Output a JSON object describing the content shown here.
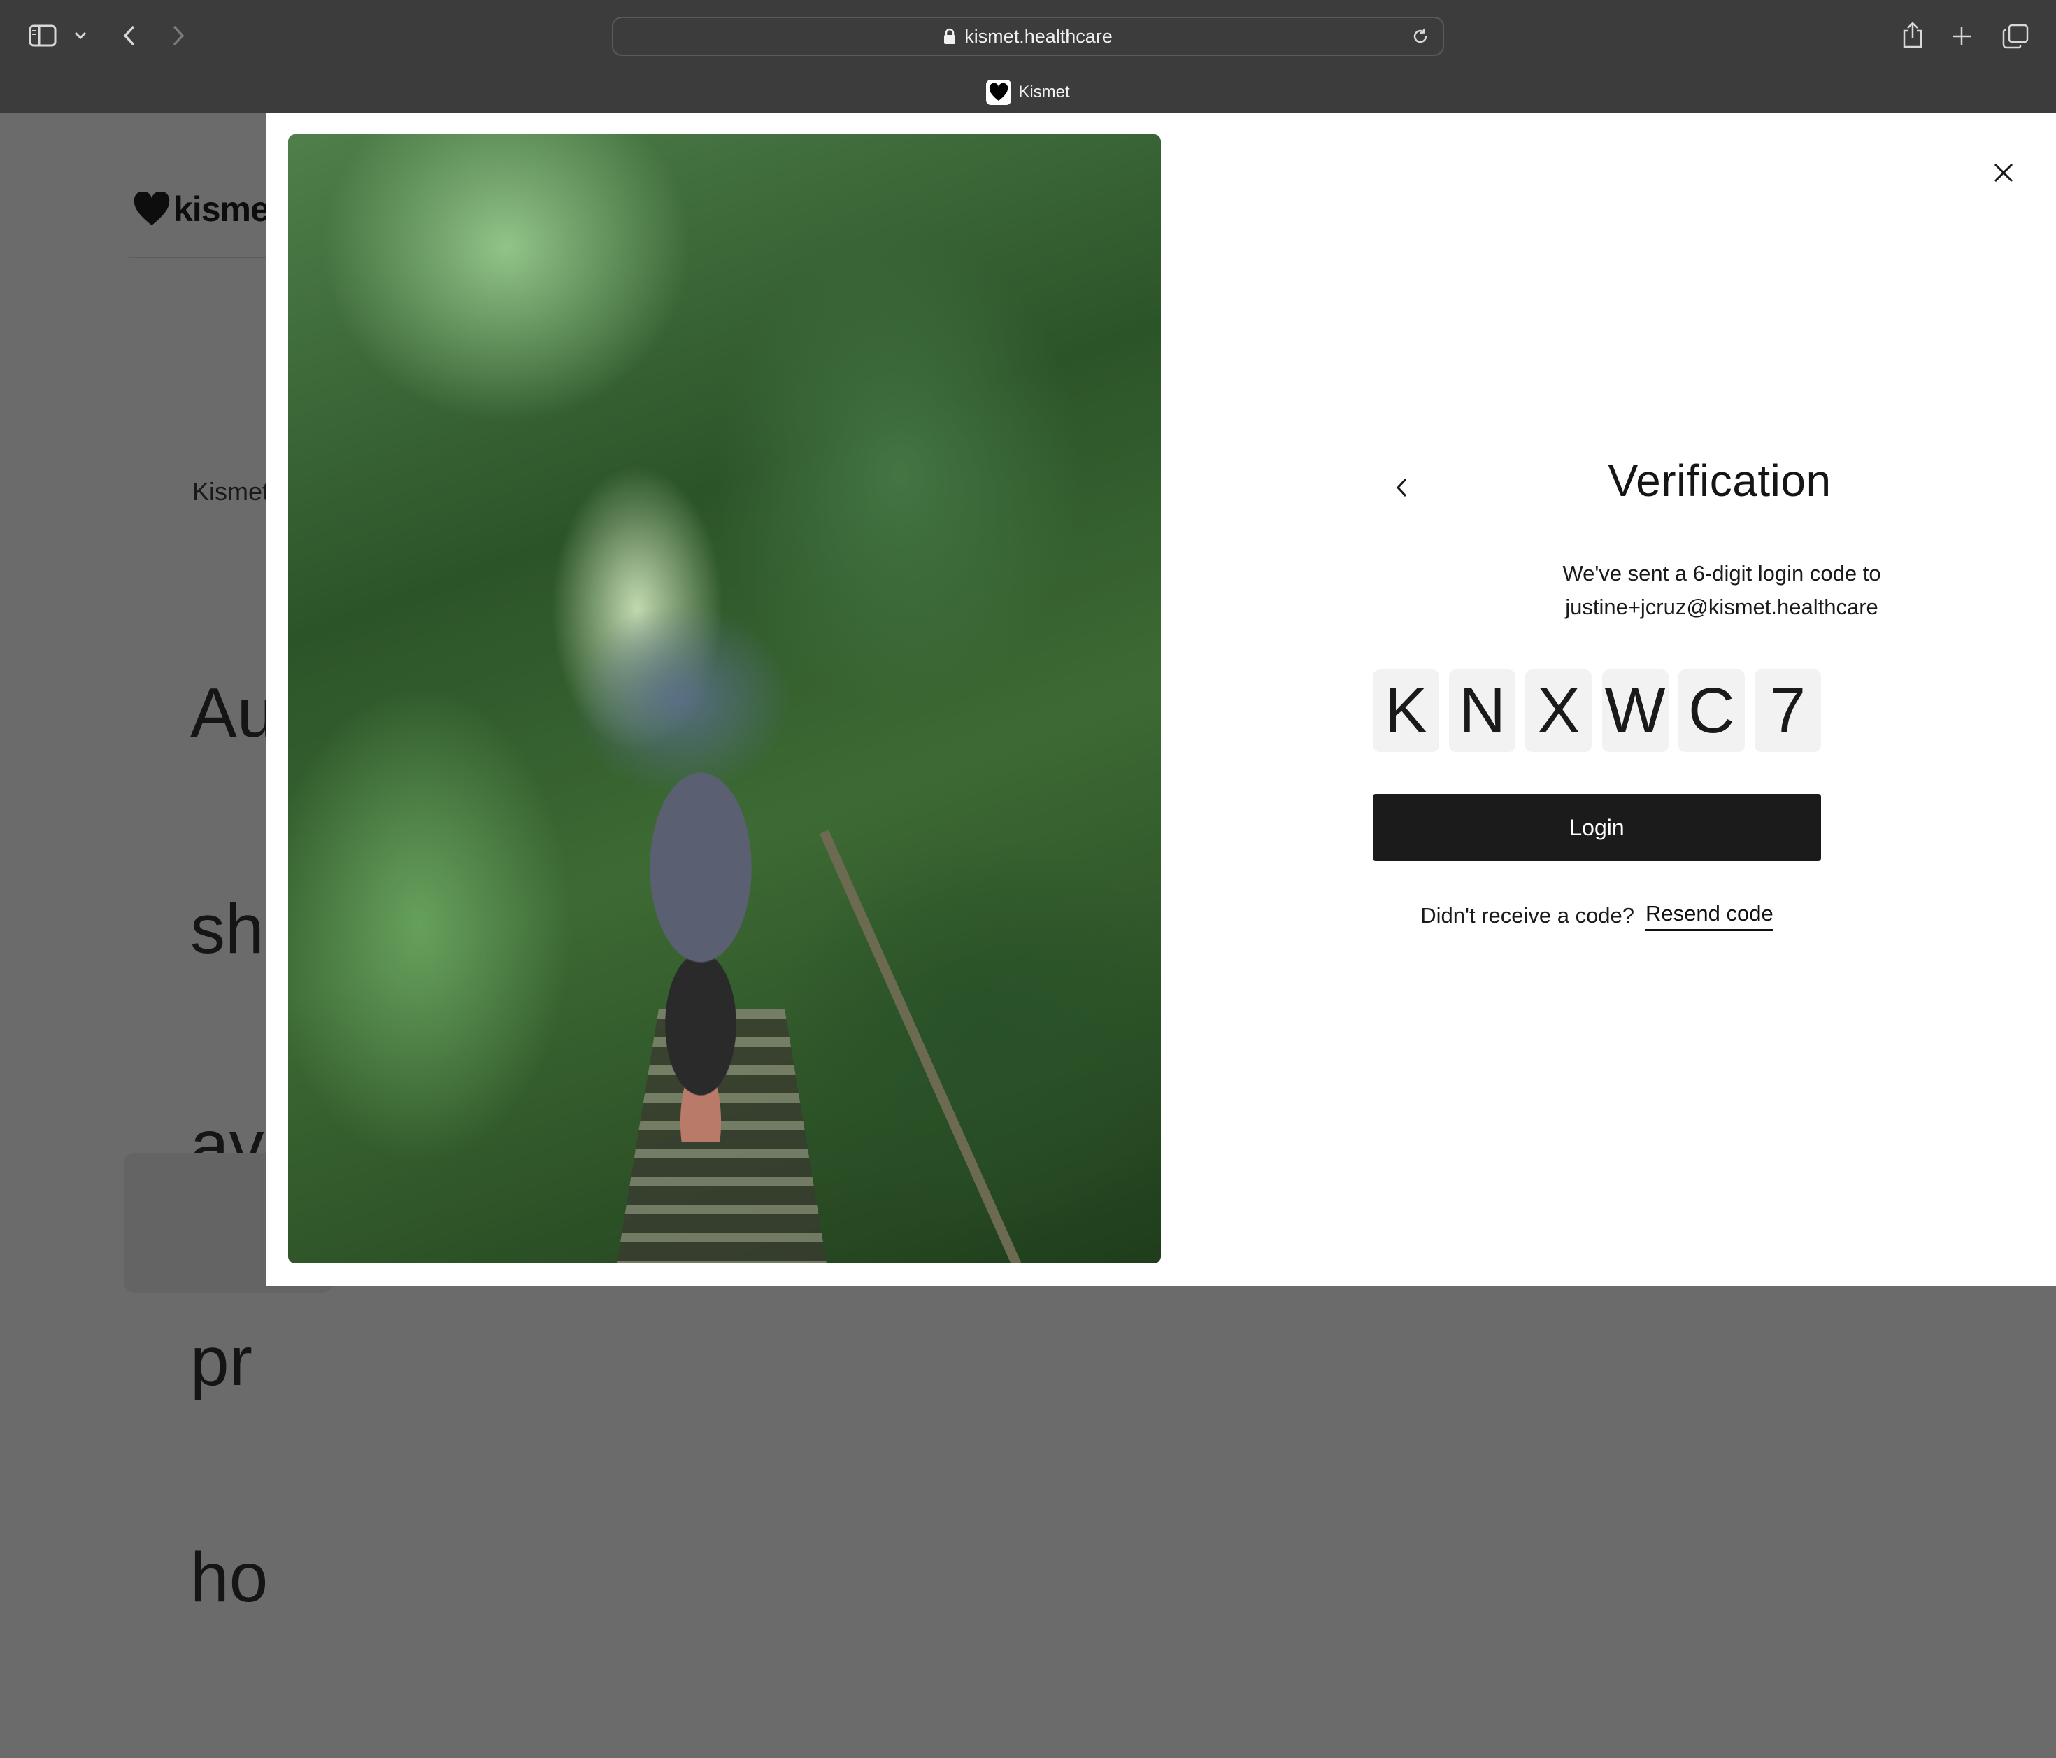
{
  "browser": {
    "url": "kismet.healthcare",
    "tab_title": "Kismet"
  },
  "background_page": {
    "logo_text": "kismet",
    "eyebrow": "Kismet",
    "headline_lines": [
      "Au",
      "sh",
      "av",
      "pr",
      "ho"
    ]
  },
  "modal": {
    "title": "Verification",
    "description": "We've sent a 6-digit login code to",
    "email": "justine+jcruz@kismet.healthcare",
    "code": [
      "K",
      "N",
      "X",
      "W",
      "C",
      "7"
    ],
    "login_label": "Login",
    "resend_prompt": "Didn't receive a code?",
    "resend_label": "Resend code"
  },
  "icons": [
    "sidebar-icon",
    "chevron-down-icon",
    "back-arrow-icon",
    "forward-arrow-icon",
    "lock-icon",
    "reload-icon",
    "share-icon",
    "plus-icon",
    "tabs-icon",
    "heart-icon",
    "close-icon",
    "chevron-left-icon"
  ],
  "colors": {
    "chrome": "#3c3c3c",
    "overlay_bg": "#6b6b6b",
    "button": "#1b1b1b",
    "code_box": "#f2f2f2"
  }
}
